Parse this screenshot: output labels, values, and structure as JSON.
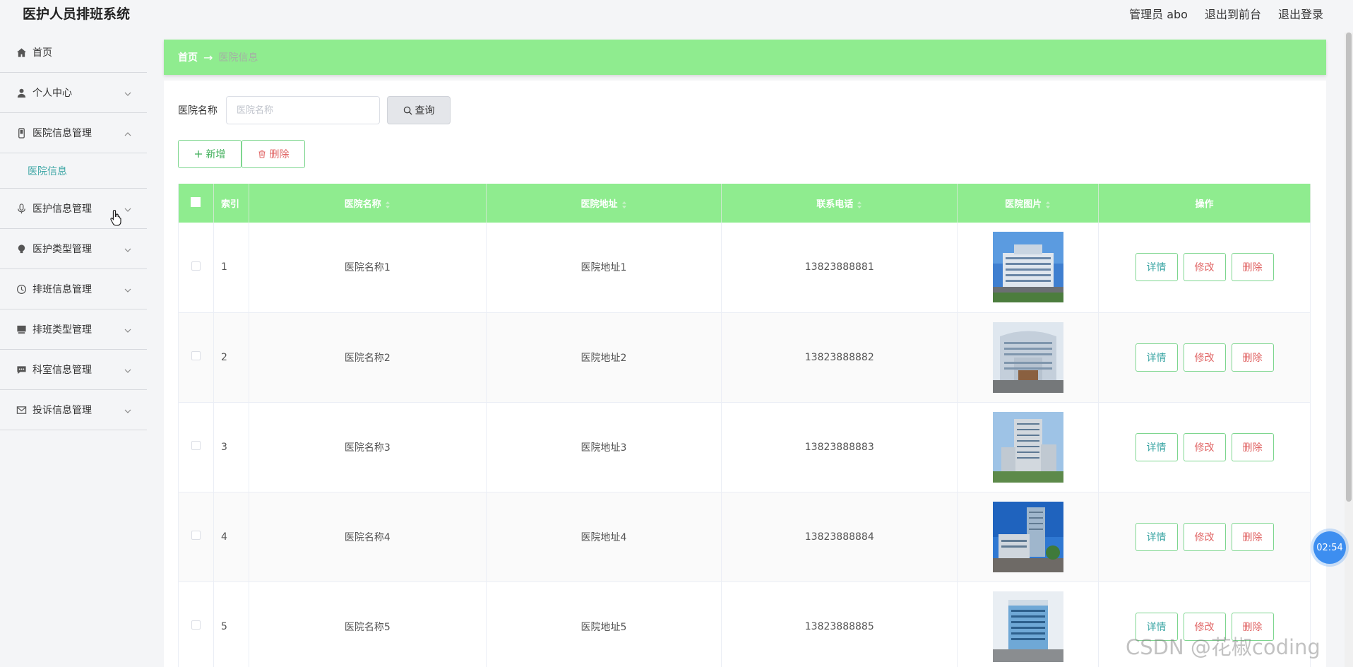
{
  "app": {
    "title": "医护人员排班系统"
  },
  "top_links": {
    "admin": "管理员 abo",
    "front": "退出到前台",
    "logout": "退出登录"
  },
  "sidebar": {
    "items": [
      {
        "label": "首页",
        "icon": "home-icon"
      },
      {
        "label": "个人中心",
        "icon": "user-icon"
      },
      {
        "label": "医院信息管理",
        "icon": "phone-icon",
        "expanded": true
      },
      {
        "label": "医院信息",
        "sub": true,
        "active": true
      },
      {
        "label": "医护信息管理",
        "icon": "microphone-icon"
      },
      {
        "label": "医护类型管理",
        "icon": "lightbulb-icon"
      },
      {
        "label": "排班信息管理",
        "icon": "clock-icon"
      },
      {
        "label": "排班类型管理",
        "icon": "monitor-icon"
      },
      {
        "label": "科室信息管理",
        "icon": "chat-icon"
      },
      {
        "label": "投诉信息管理",
        "icon": "mail-icon"
      }
    ]
  },
  "breadcrumb": {
    "home": "首页",
    "arrow": "→",
    "current": "医院信息"
  },
  "search": {
    "label": "医院名称",
    "placeholder": "医院名称",
    "value": "",
    "button": "查询"
  },
  "actions": {
    "add": "新增",
    "delete": "删除"
  },
  "table": {
    "headers": {
      "index": "索引",
      "name": "医院名称",
      "address": "医院地址",
      "phone": "联系电话",
      "image": "医院图片",
      "ops": "操作"
    },
    "rows": [
      {
        "index": "1",
        "name": "医院名称1",
        "address": "医院地址1",
        "phone": "13823888881"
      },
      {
        "index": "2",
        "name": "医院名称2",
        "address": "医院地址2",
        "phone": "13823888882"
      },
      {
        "index": "3",
        "name": "医院名称3",
        "address": "医院地址3",
        "phone": "13823888883"
      },
      {
        "index": "4",
        "name": "医院名称4",
        "address": "医院地址4",
        "phone": "13823888884"
      },
      {
        "index": "5",
        "name": "医院名称5",
        "address": "医院地址5",
        "phone": "13823888885"
      }
    ],
    "row_ops": {
      "detail": "详情",
      "edit": "修改",
      "delete": "删除"
    }
  },
  "timer": "02:54",
  "watermark": "CSDN @花椒coding",
  "colors": {
    "accent_green": "#8fec8f",
    "teal": "#3fa7a6",
    "danger": "#e06464",
    "badge_blue": "#3d8ef0"
  }
}
